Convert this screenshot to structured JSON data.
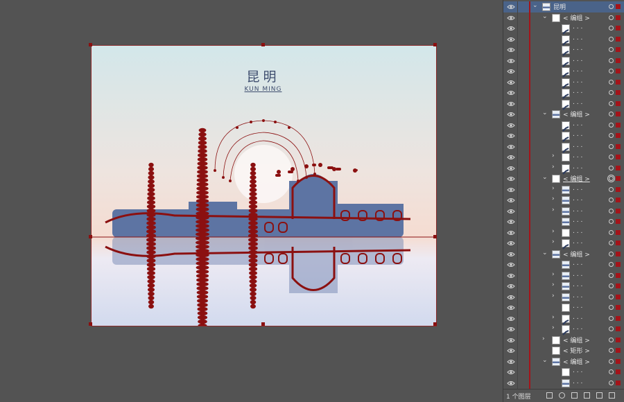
{
  "artboard": {
    "title_cn": "昆明",
    "title_en": "KUN MING"
  },
  "colors": {
    "canvas_bg": "#535353",
    "selection_red": "#8b1010",
    "layer_color": "#a3141a",
    "building_blue": "#5d74a3",
    "row_selected": "#4a6389"
  },
  "layers_panel": {
    "rows": [
      {
        "indent": 0,
        "expand": "open",
        "thumb": "image",
        "label": "昆明",
        "selected": true
      },
      {
        "indent": 1,
        "expand": "open",
        "thumb": "blank",
        "label": "< 编组 >"
      },
      {
        "indent": 2,
        "expand": "none",
        "thumb": "path",
        "label": ". . ."
      },
      {
        "indent": 2,
        "expand": "none",
        "thumb": "path",
        "label": ". . ."
      },
      {
        "indent": 2,
        "expand": "none",
        "thumb": "path",
        "label": ". . ."
      },
      {
        "indent": 2,
        "expand": "none",
        "thumb": "path",
        "label": ". . ."
      },
      {
        "indent": 2,
        "expand": "none",
        "thumb": "path",
        "label": ". . ."
      },
      {
        "indent": 2,
        "expand": "none",
        "thumb": "path",
        "label": ". . ."
      },
      {
        "indent": 2,
        "expand": "none",
        "thumb": "path",
        "label": ". . ."
      },
      {
        "indent": 2,
        "expand": "none",
        "thumb": "path",
        "label": ". . ."
      },
      {
        "indent": 1,
        "expand": "open",
        "thumb": "image",
        "label": "< 编组 >"
      },
      {
        "indent": 2,
        "expand": "none",
        "thumb": "path",
        "label": ". . ."
      },
      {
        "indent": 2,
        "expand": "none",
        "thumb": "path",
        "label": ". . ."
      },
      {
        "indent": 2,
        "expand": "none",
        "thumb": "path",
        "label": ". . ."
      },
      {
        "indent": 2,
        "expand": "closed",
        "thumb": "blank",
        "label": ". . ."
      },
      {
        "indent": 2,
        "expand": "closed",
        "thumb": "path",
        "label": ". . ."
      },
      {
        "indent": 1,
        "expand": "open",
        "thumb": "blank",
        "label": "< 编组 >",
        "target_double": true
      },
      {
        "indent": 2,
        "expand": "closed",
        "thumb": "image",
        "label": ". . ."
      },
      {
        "indent": 2,
        "expand": "closed",
        "thumb": "image",
        "label": ". . ."
      },
      {
        "indent": 2,
        "expand": "closed",
        "thumb": "image",
        "label": ". . ."
      },
      {
        "indent": 2,
        "expand": "none",
        "thumb": "image",
        "label": ". . ."
      },
      {
        "indent": 2,
        "expand": "closed",
        "thumb": "blank",
        "label": ". . ."
      },
      {
        "indent": 2,
        "expand": "closed",
        "thumb": "path",
        "label": ". . ."
      },
      {
        "indent": 1,
        "expand": "open",
        "thumb": "image",
        "label": "< 编组 >"
      },
      {
        "indent": 2,
        "expand": "none",
        "thumb": "image",
        "label": ". . ."
      },
      {
        "indent": 2,
        "expand": "closed",
        "thumb": "image",
        "label": ". . ."
      },
      {
        "indent": 2,
        "expand": "closed",
        "thumb": "image",
        "label": ". . ."
      },
      {
        "indent": 2,
        "expand": "closed",
        "thumb": "image",
        "label": ". . ."
      },
      {
        "indent": 2,
        "expand": "none",
        "thumb": "blank",
        "label": ". . ."
      },
      {
        "indent": 2,
        "expand": "closed",
        "thumb": "path",
        "label": ". . ."
      },
      {
        "indent": 2,
        "expand": "closed",
        "thumb": "path",
        "label": ". . ."
      },
      {
        "indent": 1,
        "expand": "closed",
        "thumb": "blank",
        "label": "< 编组 >"
      },
      {
        "indent": 1,
        "expand": "none",
        "thumb": "blank",
        "label": "< 矩形 >"
      },
      {
        "indent": 1,
        "expand": "open",
        "thumb": "image",
        "label": "< 编组 >"
      },
      {
        "indent": 2,
        "expand": "none",
        "thumb": "blank",
        "label": ". . ."
      },
      {
        "indent": 2,
        "expand": "none",
        "thumb": "image",
        "label": ". . ."
      },
      {
        "indent": 1,
        "expand": "none",
        "thumb": "blank",
        "label": "< 矩形 >"
      }
    ],
    "footer_label": "1 个图层",
    "footer_icons": [
      "export-icon",
      "search-icon",
      "clipping-mask-icon",
      "new-sublayer-icon",
      "new-layer-icon",
      "delete-icon"
    ]
  }
}
